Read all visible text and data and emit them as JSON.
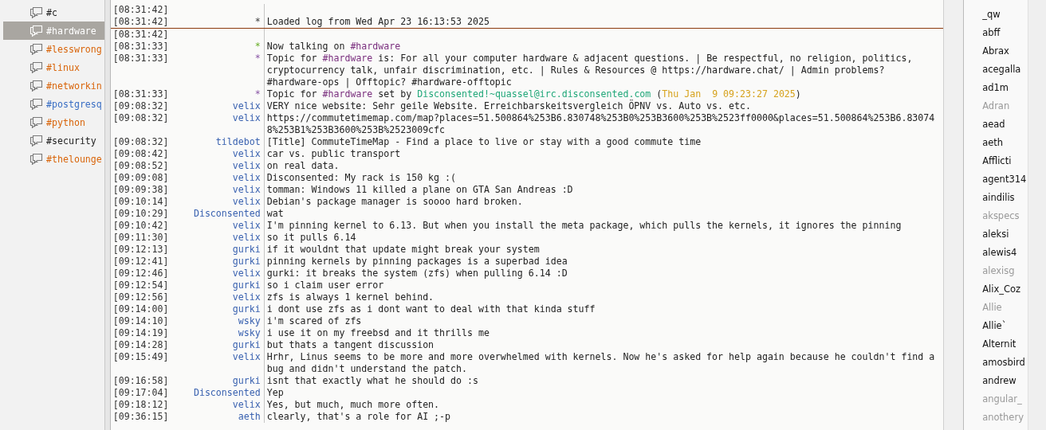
{
  "channels": [
    {
      "name": "#c",
      "selected": false,
      "color": "#1e1e1e"
    },
    {
      "name": "#hardware",
      "selected": true,
      "color": "#ffffff"
    },
    {
      "name": "#lesswrong",
      "selected": false,
      "color": "#d9650b"
    },
    {
      "name": "#linux",
      "selected": false,
      "color": "#d9650b"
    },
    {
      "name": "#networkin",
      "selected": false,
      "color": "#d9650b"
    },
    {
      "name": "#postgresq",
      "selected": false,
      "color": "#3a6fc4"
    },
    {
      "name": "#python",
      "selected": false,
      "color": "#d9650b"
    },
    {
      "name": "#security",
      "selected": false,
      "color": "#1e1e1e"
    },
    {
      "name": "#thelounge",
      "selected": false,
      "color": "#d9650b"
    }
  ],
  "messages": [
    {
      "time": "[08:31:42]"
    },
    {
      "time": "[08:31:42]",
      "kind": "log",
      "nick": "*",
      "text": "Loaded log from Wed Apr 23 16:13:53 2025",
      "last_read": true
    },
    {
      "time": "[08:31:42]"
    },
    {
      "time": "[08:31:33]",
      "kind": "join",
      "nick": "*",
      "parts": [
        {
          "text": "Now talking on "
        },
        {
          "text": "#hardware",
          "kind": "channel"
        }
      ]
    },
    {
      "time": "[08:31:33]",
      "kind": "topic",
      "nick": "*",
      "parts": [
        {
          "text": "Topic for "
        },
        {
          "text": "#hardware",
          "kind": "channel"
        },
        {
          "text": " is: For all your computer hardware & adjacent questions. | Be respectful, no religion, politics, cryptocurrency talk, unfair discrimination, etc. | Rules & Resources @ https://hardware.chat/ | Admin problems? #hardware-ops | Offtopic? #hardware-offtopic"
        }
      ]
    },
    {
      "time": "[08:31:33]",
      "kind": "topic",
      "nick": "*",
      "parts": [
        {
          "text": "Topic for "
        },
        {
          "text": "#hardware",
          "kind": "channel"
        },
        {
          "text": " set by "
        },
        {
          "text": "Disconsented!~quassel@irc.disconsented.com",
          "kind": "host"
        },
        {
          "text": " ("
        },
        {
          "text": "Thu Jan  9 09:23:27 2025",
          "kind": "date"
        },
        {
          "text": ")"
        }
      ]
    },
    {
      "time": "[09:08:32]",
      "kind": "msg",
      "nick": "velix",
      "text": "VERY nice website: Sehr geile Website. Erreichbarskeitsvergleich ÖPNV vs. Auto vs. etc."
    },
    {
      "time": "[09:08:32]",
      "kind": "msg",
      "nick": "velix",
      "text": "https://commutetimemap.com/map?places=51.500864%253B6.830748%253B0%253B3600%253B%2523ff0000&places=51.500864%253B6.830748%253B1%253B3600%253B%2523009cfc",
      "url": true
    },
    {
      "time": "[09:08:32]",
      "kind": "msg",
      "nick": "tildebot",
      "text": "[Title] CommuteTimeMap - Find a place to live or stay with a good commute time"
    },
    {
      "time": "[09:08:42]",
      "kind": "msg",
      "nick": "velix",
      "text": "car vs. public transport"
    },
    {
      "time": "[09:08:52]",
      "kind": "msg",
      "nick": "velix",
      "text": "on real data."
    },
    {
      "time": "[09:09:08]",
      "kind": "msg",
      "nick": "velix",
      "text": "Disconsented: My rack is 150 kg :("
    },
    {
      "time": "[09:09:38]",
      "kind": "msg",
      "nick": "velix",
      "text": "tomman: Windows 11 killed a plane on GTA San Andreas :D"
    },
    {
      "time": "[09:10:14]",
      "kind": "msg",
      "nick": "velix",
      "text": "Debian's package manager is soooo hard broken."
    },
    {
      "time": "[09:10:29]",
      "kind": "msg",
      "nick": "Disconsented",
      "text": "wat"
    },
    {
      "time": "[09:10:42]",
      "kind": "msg",
      "nick": "velix",
      "text": "I'm pinning kernel to 6.13. But when you install the meta package, which pulls the kernels, it ignores the pinning"
    },
    {
      "time": "[09:11:30]",
      "kind": "msg",
      "nick": "velix",
      "text": "so it pulls 6.14"
    },
    {
      "time": "[09:12:13]",
      "kind": "msg",
      "nick": "gurki",
      "text": "if it wouldnt that update might break your system"
    },
    {
      "time": "[09:12:41]",
      "kind": "msg",
      "nick": "gurki",
      "text": "pinning kernels by pinning packages is a superbad idea"
    },
    {
      "time": "[09:12:46]",
      "kind": "msg",
      "nick": "velix",
      "text": "gurki: it breaks the system (zfs) when pulling 6.14 :D"
    },
    {
      "time": "[09:12:54]",
      "kind": "msg",
      "nick": "gurki",
      "text": "so i claim user error"
    },
    {
      "time": "[09:12:56]",
      "kind": "msg",
      "nick": "velix",
      "text": "zfs is always 1 kernel behind."
    },
    {
      "time": "[09:14:00]",
      "kind": "msg",
      "nick": "gurki",
      "text": "i dont use zfs as i dont want to deal with that kinda stuff"
    },
    {
      "time": "[09:14:10]",
      "kind": "msg",
      "nick": "wsky",
      "text": "i'm scared of zfs"
    },
    {
      "time": "[09:14:19]",
      "kind": "msg",
      "nick": "wsky",
      "text": "i use it on my freebsd and it thrills me"
    },
    {
      "time": "[09:14:28]",
      "kind": "msg",
      "nick": "gurki",
      "text": "but thats a tangent discussion"
    },
    {
      "time": "[09:15:49]",
      "kind": "msg",
      "nick": "velix",
      "text": "Hrhr, Linus seems to be more and more overwhelmed with kernels. Now he's asked for help again because he couldn't find a bug and didn't understand the patch."
    },
    {
      "time": "[09:16:58]",
      "kind": "msg",
      "nick": "gurki",
      "text": "isnt that exactly what he should do :s"
    },
    {
      "time": "[09:17:04]",
      "kind": "msg",
      "nick": "Disconsented",
      "text": "Yep"
    },
    {
      "time": "[09:18:12]",
      "kind": "msg",
      "nick": "velix",
      "text": "Yes, but much, much more often."
    },
    {
      "time": "[09:36:15]",
      "kind": "msg",
      "nick": "aeth",
      "text": "clearly, that's a role for AI ;-p"
    }
  ],
  "nicks": [
    {
      "name": "_qw",
      "away": false
    },
    {
      "name": "abff",
      "away": false
    },
    {
      "name": "Abrax",
      "away": false
    },
    {
      "name": "acegalla",
      "away": false
    },
    {
      "name": "ad1m",
      "away": false
    },
    {
      "name": "Adran",
      "away": true
    },
    {
      "name": "aead",
      "away": false
    },
    {
      "name": "aeth",
      "away": false
    },
    {
      "name": "Afflicti",
      "away": false
    },
    {
      "name": "agent314",
      "away": false
    },
    {
      "name": "aindilis",
      "away": false
    },
    {
      "name": "akspecs",
      "away": true
    },
    {
      "name": "aleksi",
      "away": false
    },
    {
      "name": "alewis4",
      "away": false
    },
    {
      "name": "alexisg",
      "away": true
    },
    {
      "name": "Alix_Coz",
      "away": false
    },
    {
      "name": "Allie",
      "away": true
    },
    {
      "name": "Allie`",
      "away": false
    },
    {
      "name": "Alternit",
      "away": false
    },
    {
      "name": "amosbird",
      "away": false
    },
    {
      "name": "andrew",
      "away": false
    },
    {
      "name": "angular_",
      "away": true
    },
    {
      "name": "anothery",
      "away": true
    }
  ]
}
